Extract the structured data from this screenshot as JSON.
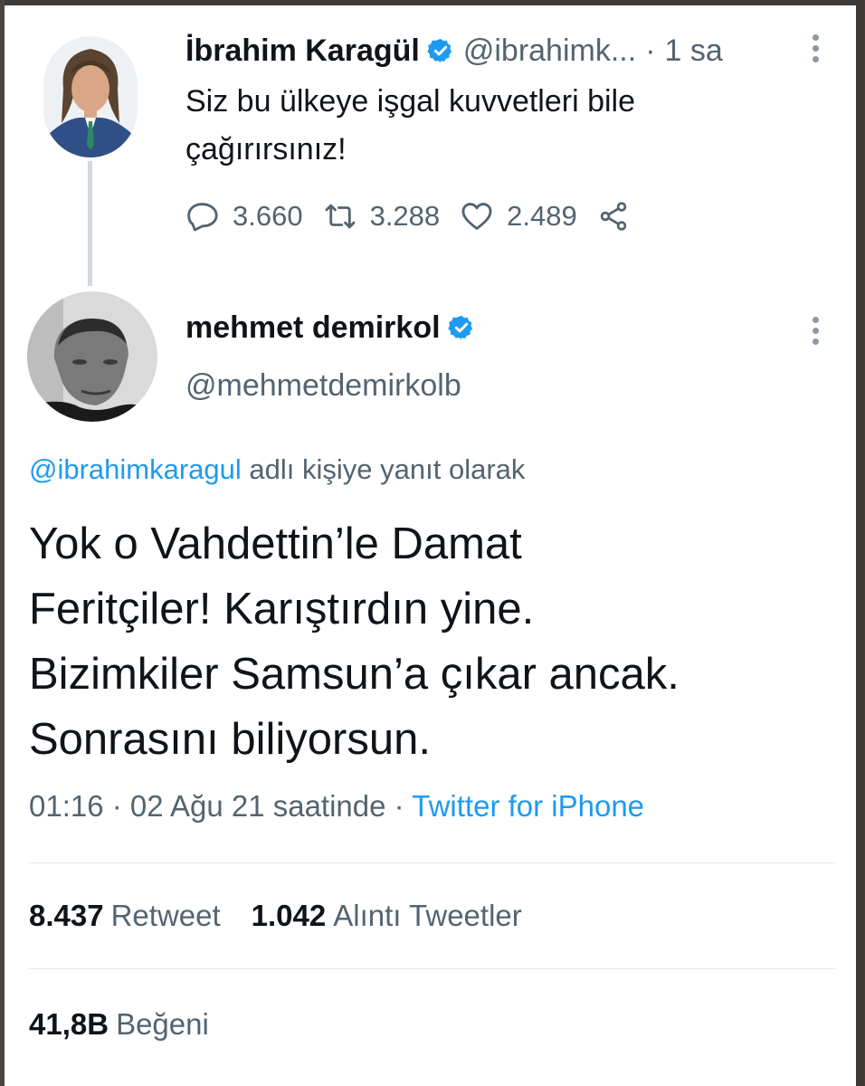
{
  "colors": {
    "accent": "#1d9bf0",
    "text": "#0f1419",
    "muted": "#536471",
    "line": "#cfd9de"
  },
  "parent_tweet": {
    "name": "İbrahim Karagül",
    "handle": "@ibrahimk...",
    "separator": "·",
    "time": "1 sa",
    "text_line1": "Siz bu ülkeye işgal kuvvetleri bile",
    "text_line2": "çağırırsınız!",
    "replies": "3.660",
    "retweets": "3.288",
    "likes": "2.489",
    "verified_icon": "verified-badge-icon"
  },
  "reply_tweet": {
    "name": "mehmet demirkol",
    "handle": "@mehmetdemirkolb",
    "replying_to_handle": "@ibrahimkaragul",
    "replying_to_suffix": "adlı kişiye yanıt olarak",
    "text_lines": [
      "Yok o Vahdettin’le Damat",
      "Feritçiler! Karıştırdın yine.",
      "Bizimkiler Samsun’a çıkar ancak.",
      "Sonrasını biliyorsun."
    ],
    "timestamp": "01:16 · 02 Ağu 21 saatinde",
    "meta_separator": "·",
    "source": "Twitter for iPhone",
    "retweet_count": "8.437",
    "retweet_label": "Retweet",
    "quote_count": "1.042",
    "quote_label": "Alıntı Tweetler",
    "like_count": "41,8B",
    "like_label": "Beğeni"
  }
}
